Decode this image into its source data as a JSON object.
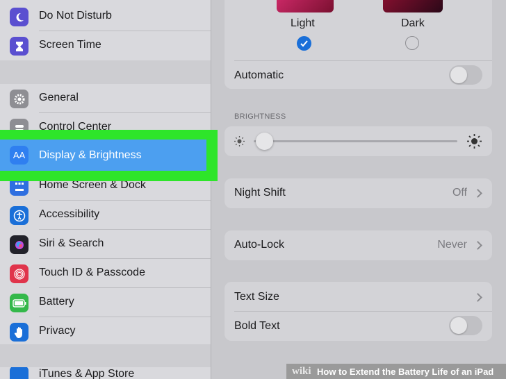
{
  "sidebar": {
    "items": [
      {
        "label": "Do Not Disturb"
      },
      {
        "label": "Screen Time"
      },
      {
        "label": "General"
      },
      {
        "label": "Control Center"
      },
      {
        "label": "Display & Brightness",
        "icon_text": "AA"
      },
      {
        "label": "Home Screen & Dock"
      },
      {
        "label": "Accessibility"
      },
      {
        "label": "Siri & Search"
      },
      {
        "label": "Touch ID & Passcode"
      },
      {
        "label": "Battery"
      },
      {
        "label": "Privacy"
      },
      {
        "label": "iTunes & App Store"
      }
    ]
  },
  "appearance": {
    "light_label": "Light",
    "dark_label": "Dark",
    "selected": "Light"
  },
  "automatic": {
    "label": "Automatic",
    "on": false
  },
  "brightness": {
    "header": "BRIGHTNESS",
    "level": 0.05
  },
  "night_shift": {
    "label": "Night Shift",
    "value": "Off"
  },
  "auto_lock": {
    "label": "Auto-Lock",
    "value": "Never"
  },
  "text_size": {
    "label": "Text Size"
  },
  "bold_text": {
    "label": "Bold Text",
    "on": false
  },
  "footer": {
    "wiki": "wiki",
    "title": "How to Extend the Battery Life of an iPad"
  },
  "colors": {
    "accent": "#4c9ff0",
    "highlight": "#2ee52a",
    "check": "#1a6fd8"
  }
}
